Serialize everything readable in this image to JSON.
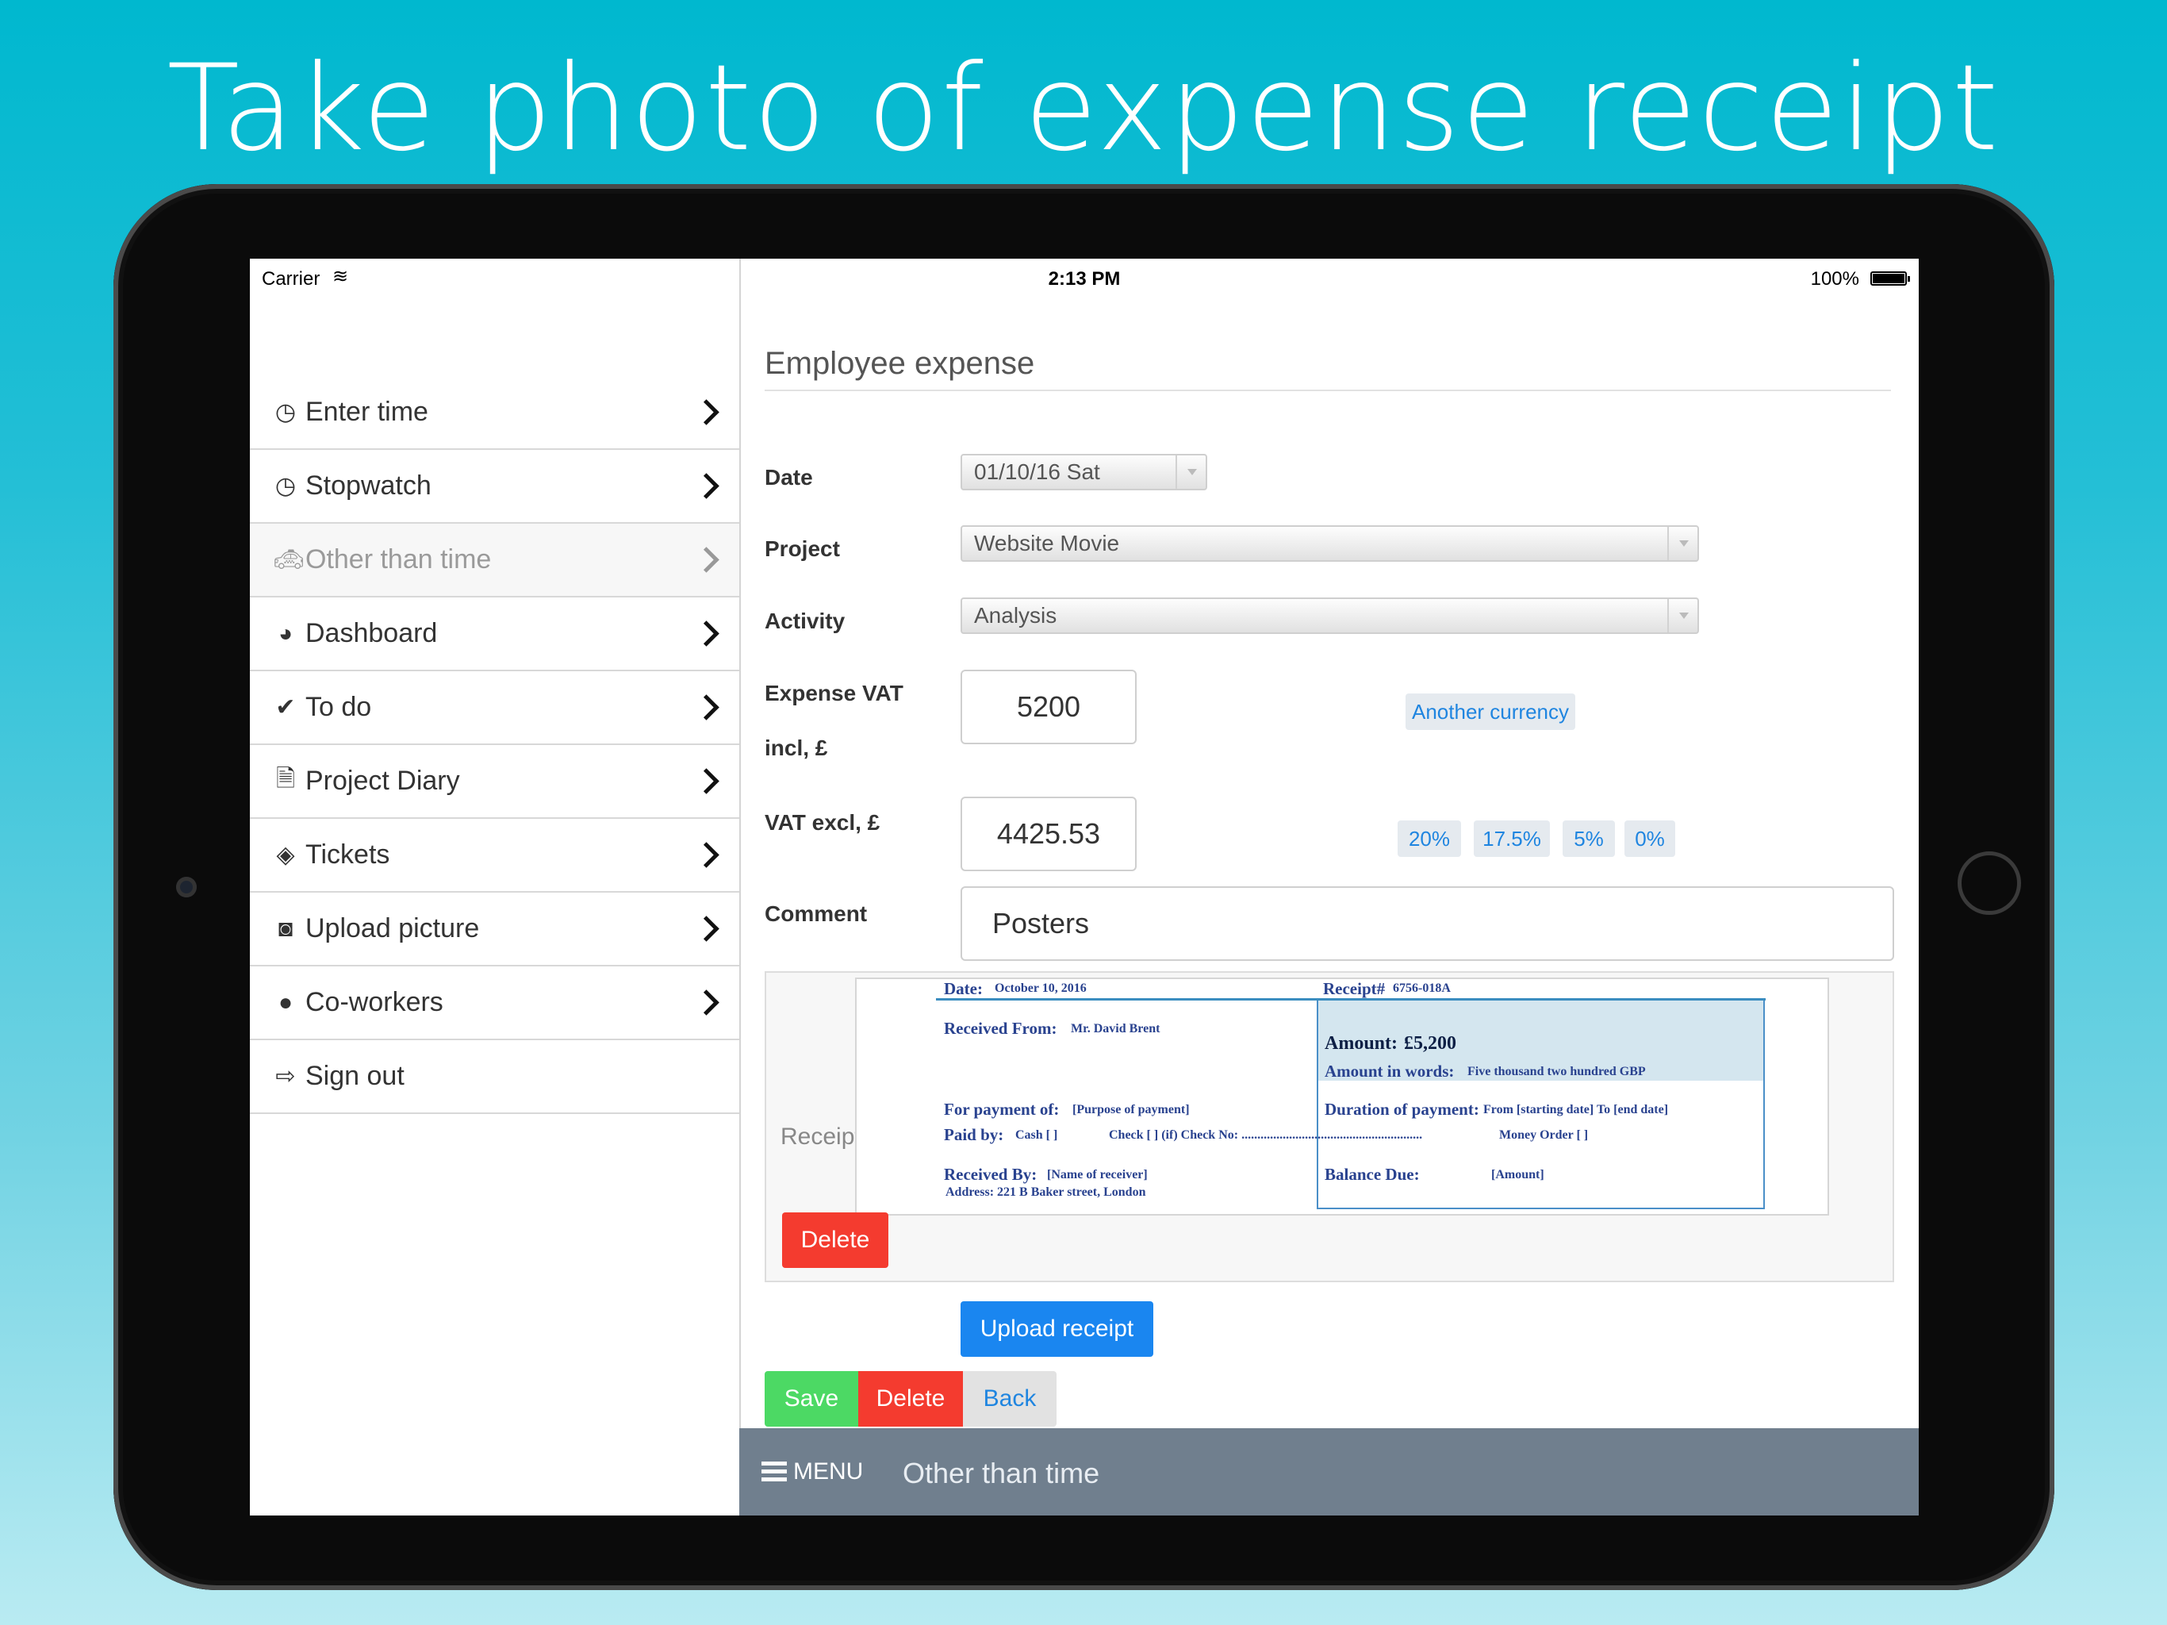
{
  "headline": "Take photo of expense receipt",
  "status_bar": {
    "carrier": "Carrier",
    "time": "2:13 PM",
    "battery": "100%"
  },
  "sidebar": {
    "items": [
      {
        "label": "Enter time",
        "icon": "clock-icon"
      },
      {
        "label": "Stopwatch",
        "icon": "clock-icon"
      },
      {
        "label": "Other than time",
        "icon": "taxi-icon",
        "active": true
      },
      {
        "label": "Dashboard",
        "icon": "dashboard-icon"
      },
      {
        "label": "To do",
        "icon": "checkmark-icon"
      },
      {
        "label": "Project Diary",
        "icon": "document-icon"
      },
      {
        "label": "Tickets",
        "icon": "ticket-icon"
      },
      {
        "label": "Upload picture",
        "icon": "camera-icon"
      },
      {
        "label": "Co-workers",
        "icon": "user-icon"
      },
      {
        "label": "Sign out",
        "icon": "sign-out-icon"
      }
    ]
  },
  "form": {
    "title": "Employee expense",
    "date_label": "Date",
    "date_value": "01/10/16 Sat",
    "project_label": "Project",
    "project_value": "Website Movie",
    "activity_label": "Activity",
    "activity_value": "Analysis",
    "expense_label_1": "Expense VAT",
    "expense_label_2": "incl, £",
    "expense_value": "5200",
    "another_currency": "Another currency",
    "vat_label": "VAT excl, £",
    "vat_value": "4425.53",
    "vat_rates": [
      "20%",
      "17.5%",
      "5%",
      "0%"
    ],
    "comment_label": "Comment",
    "comment_value": "Posters",
    "receipt_label": "Receipt",
    "receipt_delete": "Delete",
    "upload_receipt": "Upload receipt",
    "save": "Save",
    "delete": "Delete",
    "back": "Back"
  },
  "receipt": {
    "date_label": "Date:",
    "date_value": "October 10, 2016",
    "receipt_no_label": "Receipt#",
    "receipt_no_value": "6756-018A",
    "received_from_label": "Received From:",
    "received_from_value": "Mr. David Brent",
    "amount_label": "Amount:",
    "amount_value": "£5,200",
    "amount_words_label": "Amount in words:",
    "amount_words_value": "Five thousand two hundred GBP",
    "payment_for_label": "For payment of:",
    "payment_for_value": "[Purpose of payment]",
    "duration_label": "Duration of payment:",
    "duration_value": "From [starting date] To [end date]",
    "paid_by_label": "Paid by:",
    "cash": "Cash [   ]",
    "check": "Check  [   ] (if)  Check No: .........................................................",
    "money_order": "Money Order  [   ]",
    "received_by_label": "Received By:",
    "received_by_value": "[Name of receiver]",
    "address": "Address: 221 B Baker street, London",
    "balance_label": "Balance Due:",
    "balance_value": "[Amount]"
  },
  "bottom_bar": {
    "menu": "MENU",
    "section": "Other than time"
  }
}
